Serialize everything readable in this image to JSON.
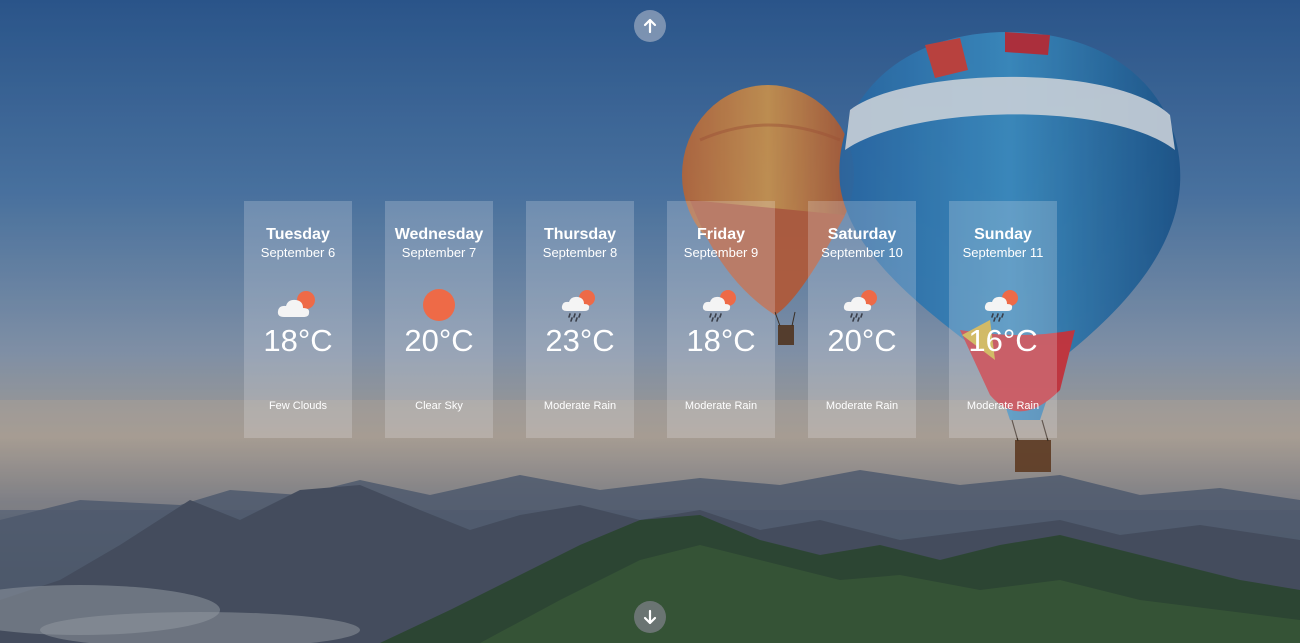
{
  "navigation": {
    "up_icon": "arrow-up-icon",
    "down_icon": "arrow-down-icon"
  },
  "forecast": [
    {
      "day": "Tuesday",
      "date": "September 6",
      "temp": "18°C",
      "description": "Few Clouds",
      "icon": "cloud-sun-icon"
    },
    {
      "day": "Wednesday",
      "date": "September 7",
      "temp": "20°C",
      "description": "Clear Sky",
      "icon": "sun-icon"
    },
    {
      "day": "Thursday",
      "date": "September 8",
      "temp": "23°C",
      "description": "Moderate Rain",
      "icon": "rain-sun-icon"
    },
    {
      "day": "Friday",
      "date": "September 9",
      "temp": "18°C",
      "description": "Moderate Rain",
      "icon": "rain-sun-icon"
    },
    {
      "day": "Saturday",
      "date": "September 10",
      "temp": "20°C",
      "description": "Moderate Rain",
      "icon": "rain-sun-icon"
    },
    {
      "day": "Sunday",
      "date": "September 11",
      "temp": "16°C",
      "description": "Moderate Rain",
      "icon": "rain-sun-icon"
    }
  ],
  "colors": {
    "sun": "#ee6a47",
    "cloud": "#f4f4f4",
    "card": "rgba(240,240,245,0.22)"
  }
}
